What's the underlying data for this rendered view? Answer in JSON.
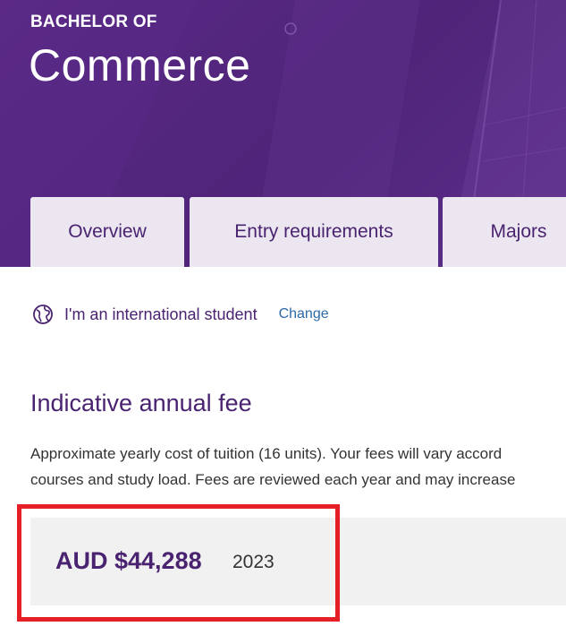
{
  "hero": {
    "kicker": "BACHELOR OF",
    "title": "Commerce"
  },
  "tabs": [
    {
      "label": "Overview"
    },
    {
      "label": "Entry requirements"
    },
    {
      "label": "Majors"
    }
  ],
  "student_type": {
    "icon": "globe-icon",
    "label": "I'm an international student",
    "change_label": "Change"
  },
  "fees": {
    "heading": "Indicative annual fee",
    "description_line1": "Approximate yearly cost of tuition (16 units). Your fees will vary accord",
    "description_line2": "courses and study load. Fees are reviewed each year and may increase",
    "amount": "AUD $44,288",
    "year": "2023"
  },
  "colors": {
    "brand_purple": "#4f2479",
    "tab_bg": "#ebe6f0",
    "link_blue": "#2d6aa6",
    "highlight_red": "#e41f26",
    "fee_box_bg": "#f1f1f1"
  }
}
